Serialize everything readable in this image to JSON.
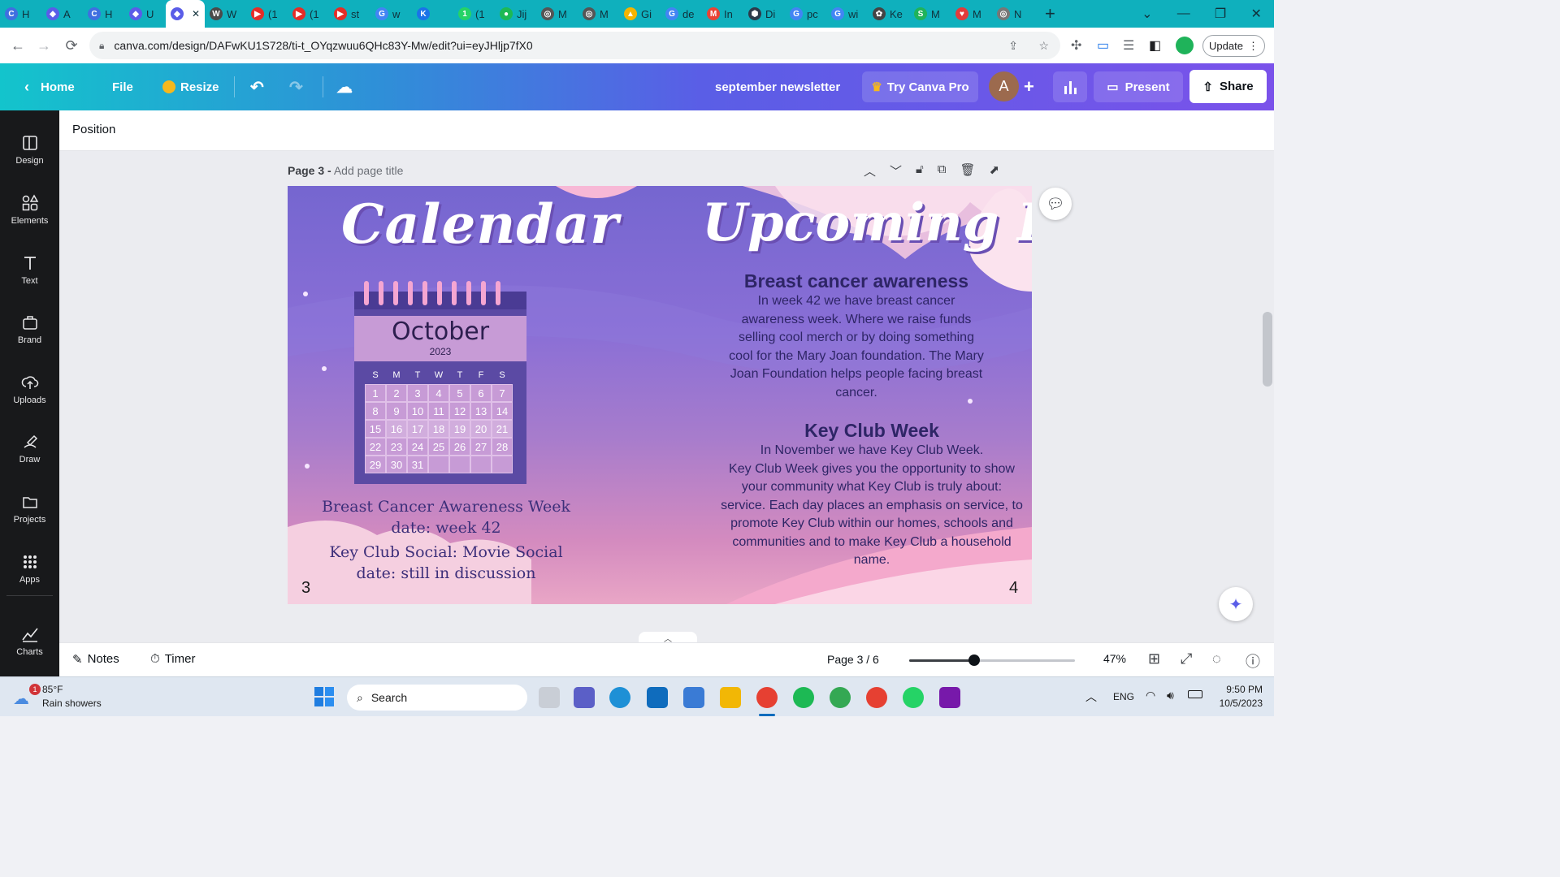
{
  "browser": {
    "tabs": [
      {
        "label": "H",
        "color": "#3f6fe0",
        "glyph": "C"
      },
      {
        "label": "A",
        "color": "#5a5de8",
        "glyph": "◆"
      },
      {
        "label": "H",
        "color": "#3f6fe0",
        "glyph": "C"
      },
      {
        "label": "U",
        "color": "#5a5de8",
        "glyph": "◆"
      },
      {
        "label": "",
        "color": "#5a5de8",
        "glyph": "◆",
        "active": true
      },
      {
        "label": "W",
        "color": "#4a4a4a",
        "glyph": "W"
      },
      {
        "label": "(1",
        "color": "#e52d27",
        "glyph": "▶"
      },
      {
        "label": "(1",
        "color": "#e52d27",
        "glyph": "▶"
      },
      {
        "label": "st",
        "color": "#e52d27",
        "glyph": "▶"
      },
      {
        "label": "w",
        "color": "#4285f4",
        "glyph": "G"
      },
      {
        "label": "",
        "color": "#1a73e8",
        "glyph": "K"
      },
      {
        "label": "(1",
        "color": "#25d366",
        "glyph": "1"
      },
      {
        "label": "Jij",
        "color": "#1db954",
        "glyph": "●"
      },
      {
        "label": "M",
        "color": "#555",
        "glyph": "◎"
      },
      {
        "label": "M",
        "color": "#555",
        "glyph": "◎"
      },
      {
        "label": "Gi",
        "color": "#f4b400",
        "glyph": "▲"
      },
      {
        "label": "de",
        "color": "#4285f4",
        "glyph": "G"
      },
      {
        "label": "In",
        "color": "#ea4335",
        "glyph": "M"
      },
      {
        "label": "Di",
        "color": "#2d3a4a",
        "glyph": "⬢"
      },
      {
        "label": "pc",
        "color": "#4285f4",
        "glyph": "G"
      },
      {
        "label": "wi",
        "color": "#4285f4",
        "glyph": "G"
      },
      {
        "label": "Ke",
        "color": "#444",
        "glyph": "✿"
      },
      {
        "label": "M",
        "color": "#1fb35a",
        "glyph": "S"
      },
      {
        "label": "M",
        "color": "#e23b3b",
        "glyph": "♥"
      },
      {
        "label": "N",
        "color": "#777",
        "glyph": "◎"
      }
    ],
    "new_tab": "+",
    "url": "canva.com/design/DAFwKU1S728/ti-t_OYqzwuu6QHc83Y-Mw/edit?ui=eyJHljp7fX0",
    "update_label": "Update"
  },
  "header": {
    "home": "Home",
    "file": "File",
    "resize": "Resize",
    "doc_title": "september newsletter",
    "try_pro": "Try Canva Pro",
    "avatar": "A",
    "present": "Present",
    "share": "Share"
  },
  "rail": [
    {
      "label": "Design",
      "icon": "design-icon"
    },
    {
      "label": "Elements",
      "icon": "elements-icon"
    },
    {
      "label": "Text",
      "icon": "text-icon"
    },
    {
      "label": "Brand",
      "icon": "brand-icon"
    },
    {
      "label": "Uploads",
      "icon": "uploads-icon"
    },
    {
      "label": "Draw",
      "icon": "draw-icon"
    },
    {
      "label": "Projects",
      "icon": "projects-icon"
    },
    {
      "label": "Apps",
      "icon": "apps-icon"
    },
    {
      "label": "Charts",
      "icon": "charts-icon"
    }
  ],
  "toolbar": {
    "position": "Position"
  },
  "page_header": {
    "prefix": "Page 3 -",
    "placeholder": "Add page title"
  },
  "design": {
    "calendar_title": "Calendar",
    "events_title": "Upcoming Events",
    "month": "October",
    "year": "2023",
    "weekdays": [
      "S",
      "M",
      "T",
      "W",
      "T",
      "F",
      "S"
    ],
    "weeks": [
      [
        "1",
        "2",
        "3",
        "4",
        "5",
        "6",
        "7"
      ],
      [
        "8",
        "9",
        "10",
        "11",
        "12",
        "13",
        "14"
      ],
      [
        "15",
        "16",
        "17",
        "18",
        "19",
        "20",
        "21"
      ],
      [
        "22",
        "23",
        "24",
        "25",
        "26",
        "27",
        "28"
      ],
      [
        "29",
        "30",
        "31",
        "",
        "",
        "",
        ""
      ]
    ],
    "left_line1": "Breast Cancer Awareness Week",
    "left_line2": "date: week 42",
    "left_line3": "Key Club Social: Movie Social",
    "left_line4": "date: still in discussion",
    "event1_title": "Breast cancer awareness",
    "event1_body": "In week 42 we have breast cancer awareness week. Where we raise funds selling cool merch or by doing something cool for the Mary Joan foundation. The Mary Joan Foundation helps people facing breast cancer.",
    "event2_title": "Key Club Week",
    "event2_line1": "In November we have Key Club Week.",
    "event2_body": "Key Club Week gives you the opportunity to show your community what Key Club is truly about: service. Each day places an emphasis on service, to promote Key Club within our homes, schools and communities and to make Key Club a household name.",
    "page_num_left": "3",
    "page_num_right": "4"
  },
  "bottom": {
    "notes": "Notes",
    "timer": "Timer",
    "page_indicator": "Page 3 / 6",
    "zoom_pct": "47%",
    "zoom_level": 0.39
  },
  "taskbar": {
    "weather_temp": "85°F",
    "weather_desc": "Rain showers",
    "weather_badge": "1",
    "search": "Search",
    "lang": "ENG",
    "time": "9:50 PM",
    "date": "10/5/2023"
  }
}
